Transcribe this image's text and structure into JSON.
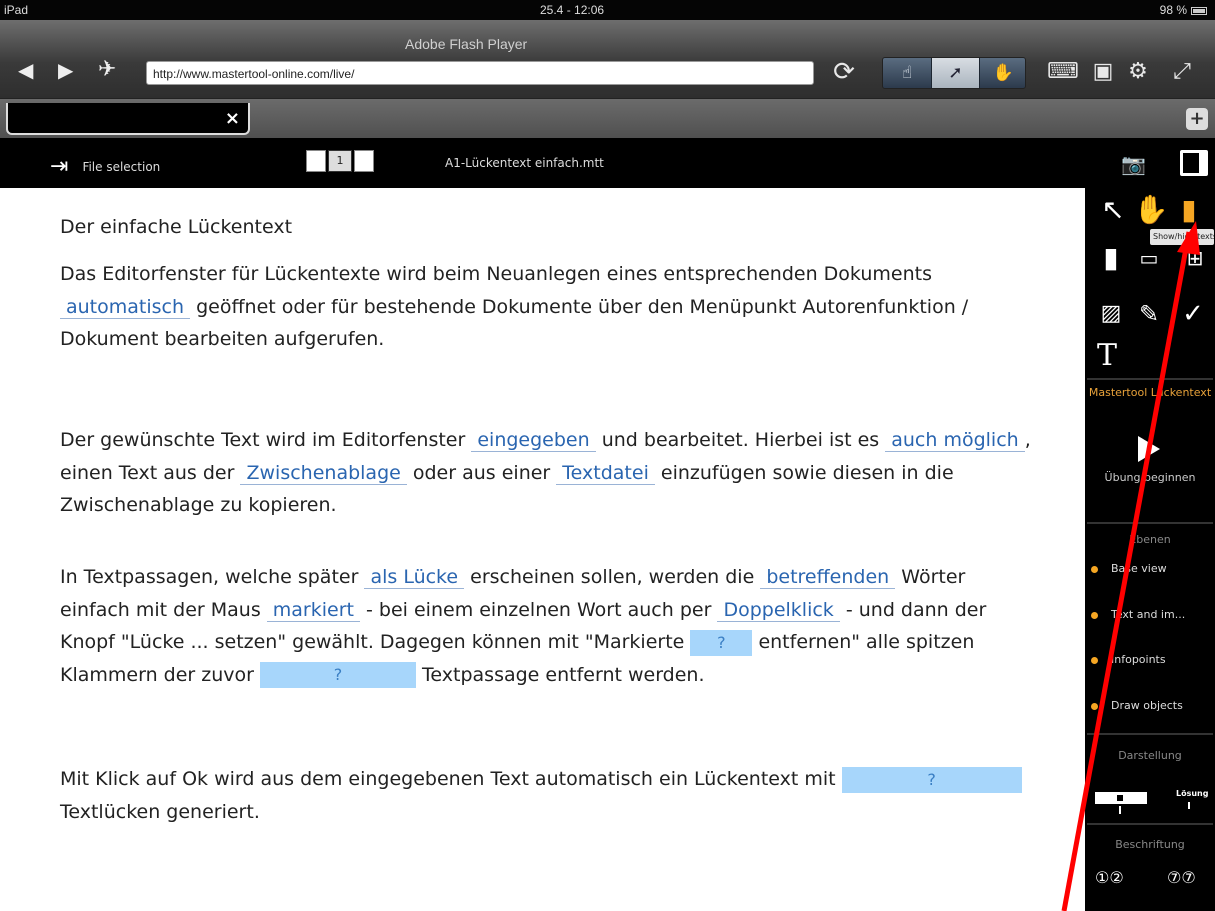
{
  "status": {
    "device": "iPad",
    "time": "25.4 - 12:06",
    "battery": "98 %"
  },
  "browser": {
    "player_title": "Adobe Flash Player",
    "url": "http://www.mastertool-online.com/live/"
  },
  "tab": {
    "close": "×",
    "add": "+"
  },
  "header": {
    "file_selection": "File selection",
    "page_number": "1",
    "file_name": "A1-Lückentext einfach.mtt"
  },
  "content": {
    "title": "Der einfache Lückentext",
    "p1": {
      "a": "Das Editorfenster für Lückentexte wird beim Neuanlegen eines entsprechenden Dokuments",
      "gap1": "automatisch",
      "b": "geöffnet oder für bestehende Dokumente über den Menüpunkt Autorenfunktion / Dokument bearbeiten aufgerufen."
    },
    "p2": {
      "a": "Der gewünschte Text wird im Editorfenster",
      "gap1": "eingegeben",
      "b": "und bearbeitet. Hierbei ist es",
      "gap2": "auch möglich",
      "c": ", einen Text aus der",
      "gap3": "Zwischenablage",
      "d": "oder aus einer",
      "gap4": "Textdatei",
      "e": "einzufügen sowie diesen in die Zwischenablage zu kopieren."
    },
    "p3": {
      "a": "In Textpassagen, welche später",
      "gap1": "als Lücke",
      "b": "erscheinen sollen, werden die",
      "gap2": "betreffenden",
      "c": "Wörter einfach mit der Maus",
      "gap3": "markiert",
      "d": "- bei einem einzelnen Wort auch per",
      "gap4": "Doppelklick",
      "e": "- und dann der Knopf \"Lücke ... setzen\" gewählt. Dagegen können mit \"Markierte",
      "box1": "?",
      "f": "entfernen\" alle spitzen Klammern der zuvor",
      "box2": "?",
      "g": "Textpassage entfernt werden."
    },
    "p4": {
      "a": "Mit Klick auf Ok wird aus dem eingegebenen Text automatisch ein Lückentext mit",
      "box1": "?",
      "b": "Textlücken generiert."
    }
  },
  "sidebar": {
    "tooltip": "Show/hide texts",
    "mastertool_label": "Mastertool Lückentext",
    "start_label": "Übung beginnen",
    "layers_title": "Ebenen",
    "layers": [
      "Base view",
      "Text and im...",
      "Infopoints",
      "Draw objects"
    ],
    "display_title": "Darstellung",
    "solution_label": "Lösung",
    "labeling_title": "Beschriftung"
  },
  "colors": {
    "accent": "#f5a623",
    "gap_text": "#2a65b0",
    "box_fill": "#a7d6fb",
    "annotation": "#ff0000"
  }
}
